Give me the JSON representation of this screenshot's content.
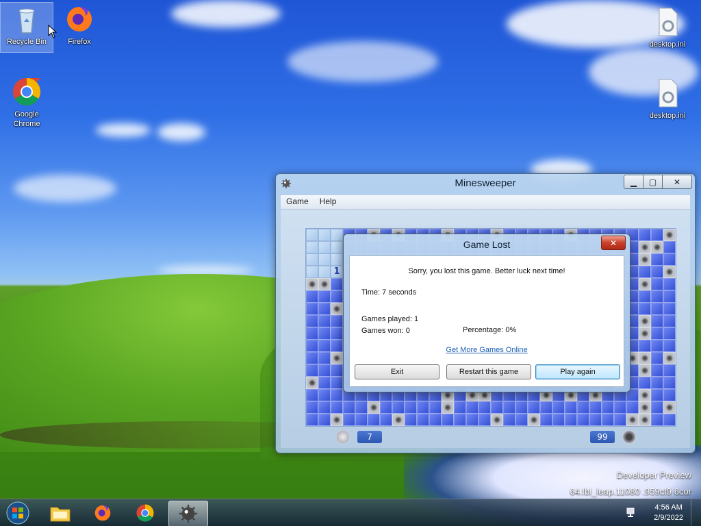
{
  "desktop": {
    "icons": [
      {
        "label": "Recycle Bin",
        "icon": "recycle-bin-icon"
      },
      {
        "label": "Firefox",
        "icon": "firefox-icon"
      },
      {
        "label": "Google Chrome",
        "icon": "chrome-icon"
      },
      {
        "label": "desktop.ini",
        "icon": "ini-file-icon"
      },
      {
        "label": "desktop.ini",
        "icon": "ini-file-icon"
      }
    ],
    "watermark_line1": "Developer Preview",
    "watermark_line2": "64.fbl_leap.11080 .959cf9 6cor"
  },
  "minesweeper": {
    "title": "Minesweeper",
    "menu": [
      "Game",
      "Help"
    ],
    "time_counter": "7",
    "mine_counter": "99",
    "revealed_number": "1"
  },
  "dialog": {
    "title": "Game Lost",
    "message": "Sorry, you lost this game. Better luck next time!",
    "time": "Time: 7 seconds",
    "games_played": "Games played: 1",
    "games_won": "Games won: 0",
    "percentage": "Percentage: 0%",
    "link": "Get More Games Online",
    "buttons": {
      "exit": "Exit",
      "restart": "Restart this game",
      "play_again": "Play again"
    },
    "close_glyph": "✕"
  },
  "taskbar": {
    "time": "4:56 AM",
    "date": "2/9/2022",
    "items": [
      "start-orb-icon",
      "file-explorer-icon",
      "firefox-icon",
      "chrome-icon",
      "minesweeper-icon"
    ]
  },
  "colors": {
    "board_unopened": "#3a55d8",
    "board_open": "#cfe3f8",
    "dialog_default_button": "#bee6fd"
  }
}
